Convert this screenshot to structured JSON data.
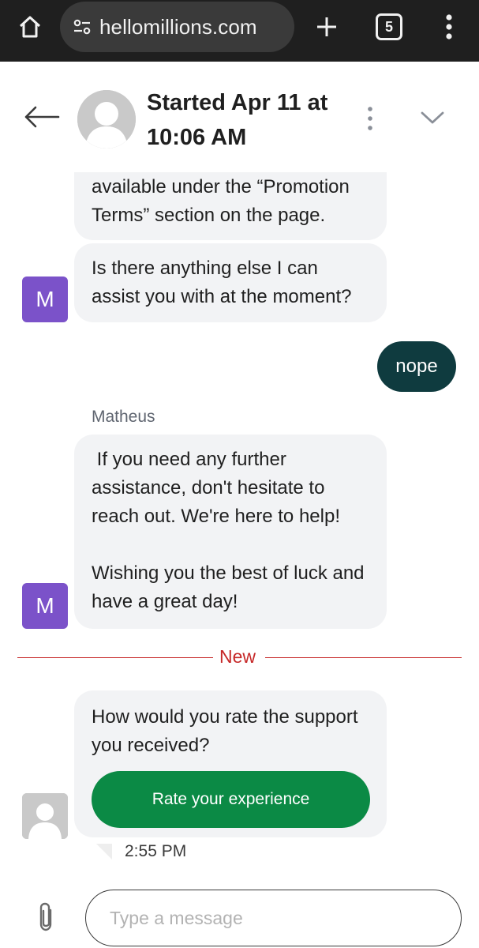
{
  "browser": {
    "url": "hellomillions.com",
    "tab_count": "5",
    "icons": [
      "home-icon",
      "tune-icon",
      "plus-icon",
      "tabs-icon",
      "more-vert-icon"
    ]
  },
  "header": {
    "title": "Started Apr 11 at 10:06 AM",
    "icons": [
      "back-arrow-icon",
      "kebab-icon",
      "chevron-down-icon"
    ]
  },
  "messages": {
    "agent_1_text": "available under the “Promotion Terms” section on the page.",
    "agent_2_text": "Is there anything else I can assist you with at the moment?",
    "agent_avatar_letter": "M",
    "user_reply": "nope",
    "sender_name": "Matheus",
    "agent_3_para1": " If you need any further assistance, don't hesitate to reach out. We're here to help!",
    "agent_3_para2": "Wishing you the best of luck and have a great day!",
    "new_divider": "New",
    "survey_text": "How would you rate the support you received?",
    "rate_button": "Rate your experience",
    "timestamp": "2:55 PM"
  },
  "composer": {
    "placeholder": "Type a message"
  },
  "colors": {
    "browser_bar": "#1f1f1f",
    "agent_avatar": "#7b52c9",
    "user_bubble": "#0f3b3f",
    "rate_button": "#0b8a45",
    "new_divider": "#c62828",
    "bubble": "#f2f3f5"
  }
}
